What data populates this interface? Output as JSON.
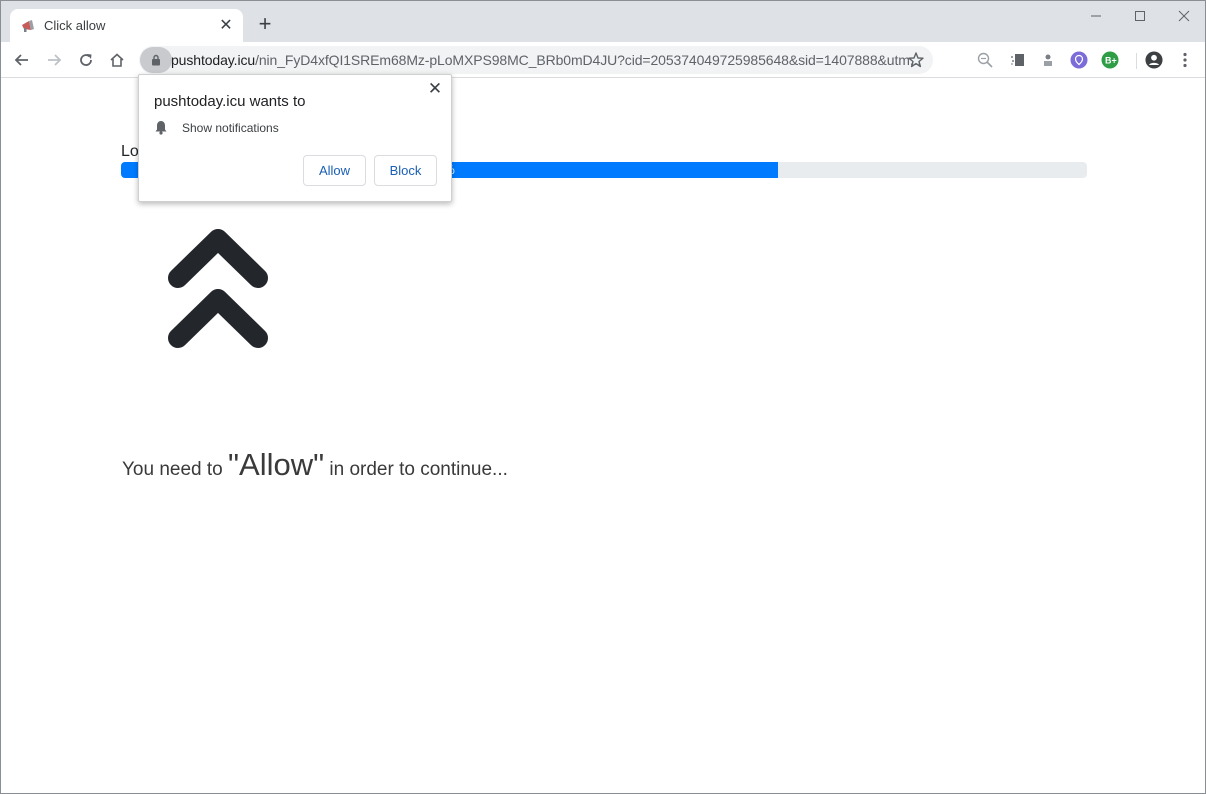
{
  "browser": {
    "tab": {
      "title": "Click allow",
      "favicon": "megaphone-icon"
    },
    "new_tab_label": "+",
    "window_controls": [
      "minimize",
      "maximize",
      "close"
    ],
    "toolbar": {
      "back": "back-arrow-icon",
      "forward": "forward-arrow-icon",
      "reload": "reload-icon",
      "home": "home-icon"
    },
    "omnibox": {
      "host": "pushtoday.icu",
      "path": "/nin_FyD4xfQI1SREm68Mz-pLoMXPS98MC_BRb0mD4JU?cid=205374049725985648&sid=1407888&utm...",
      "bookmark_icon": "star-icon"
    },
    "extensions": [
      "zoom-icon",
      "extension-icon-1",
      "extension-icon-2",
      "vpn-shield-icon",
      "b-plus-icon"
    ],
    "profile_icon": "account-icon",
    "menu_icon": "kebab-menu-icon"
  },
  "permission_popup": {
    "title": "pushtoday.icu wants to",
    "permission": "Show notifications",
    "allow_label": "Allow",
    "block_label": "Block"
  },
  "page": {
    "loading_label": "Lo",
    "progress_percent": 68,
    "progress_text": "%",
    "message_pre": "You need to ",
    "message_highlight": "\"Allow\"",
    "message_post": " in order to continue...",
    "colors": {
      "progress": "#007bff",
      "track": "#e9ecef",
      "arrows": "#23272b"
    }
  }
}
